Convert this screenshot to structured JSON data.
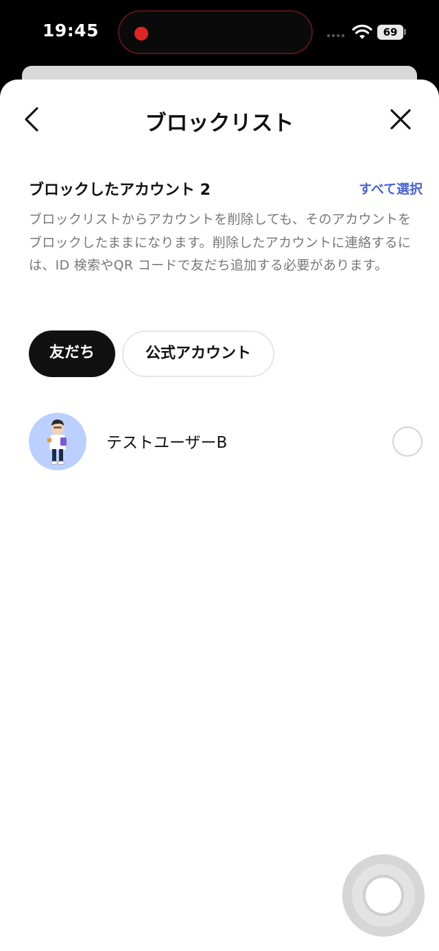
{
  "status_bar": {
    "time": "19:45",
    "battery": "69"
  },
  "nav": {
    "title": "ブロックリスト"
  },
  "section": {
    "title": "ブロックしたアカウント 2",
    "select_all": "すべて選択",
    "description": "ブロックリストからアカウントを削除しても、そのアカウントをブロックしたままになります。削除したアカウントに連絡するには、ID 検索やQR コードで友だち追加する必要があります。"
  },
  "tabs": [
    {
      "label": "友だち",
      "selected": true
    },
    {
      "label": "公式アカウント",
      "selected": false
    }
  ],
  "users": [
    {
      "name": "テストユーザーB",
      "selected": false
    }
  ],
  "colors": {
    "accent": "#4a63d6",
    "recording": "#e02525",
    "chip_selected": "#111111",
    "avatar_bg": "#bcd0ff"
  }
}
